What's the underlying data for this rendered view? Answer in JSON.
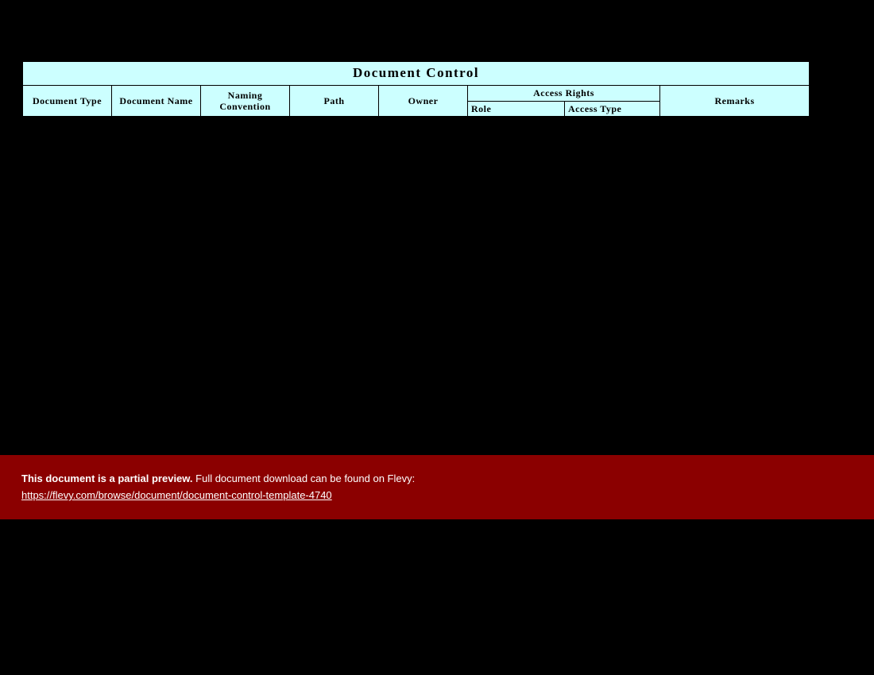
{
  "title": "Document  Control",
  "columns": {
    "doc_type": "Document Type",
    "doc_name": "Document Name",
    "naming_conv_l1": "Naming",
    "naming_conv_l2": "Convention",
    "path": "Path",
    "owner": "Owner",
    "access_rights": "Access Rights",
    "role": "Role",
    "access_type": "Access Type",
    "remarks": "Remarks"
  },
  "banner": {
    "bold": "This document is a partial preview.",
    "rest": "  Full document download can be found on Flevy:",
    "link": "https://flevy.com/browse/document/document-control-template-4740"
  }
}
